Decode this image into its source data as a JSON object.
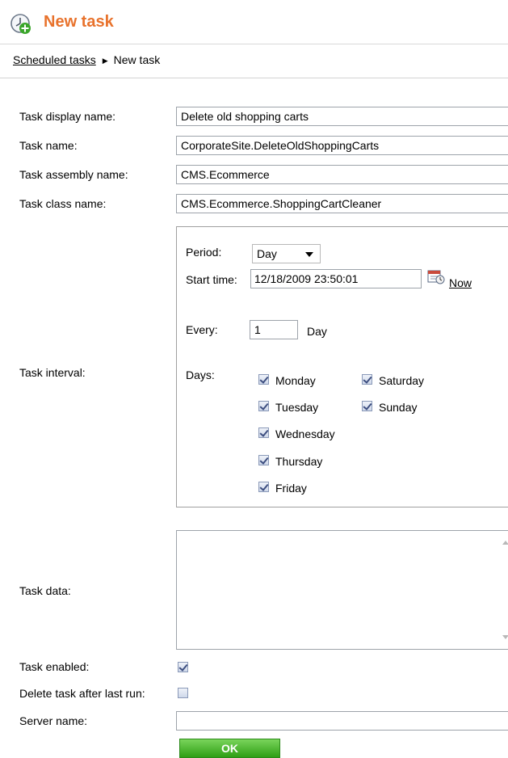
{
  "header": {
    "title": "New task",
    "icon": "scheduled-task-add-icon"
  },
  "breadcrumb": {
    "parent": "Scheduled tasks",
    "separator_icon": "triangle-right-icon",
    "current": "New task"
  },
  "form": {
    "display_name": {
      "label": "Task display name:",
      "value": "Delete old shopping carts"
    },
    "task_name": {
      "label": "Task name:",
      "value": "CorporateSite.DeleteOldShoppingCarts"
    },
    "assembly_name": {
      "label": "Task assembly name:",
      "value": "CMS.Ecommerce"
    },
    "class_name": {
      "label": "Task class name:",
      "value": "CMS.Ecommerce.ShoppingCartCleaner"
    },
    "interval": {
      "label": "Task interval:",
      "period_label": "Period:",
      "period_value": "Day",
      "start_time_label": "Start time:",
      "start_time_value": "12/18/2009 23:50:01",
      "calendar_icon": "calendar-icon",
      "now_link": "Now",
      "every_label": "Every:",
      "every_value": "1",
      "every_unit": "Day",
      "days_label": "Days:",
      "days": [
        {
          "name": "Monday",
          "checked": true
        },
        {
          "name": "Tuesday",
          "checked": true
        },
        {
          "name": "Wednesday",
          "checked": true
        },
        {
          "name": "Thursday",
          "checked": true
        },
        {
          "name": "Friday",
          "checked": true
        },
        {
          "name": "Saturday",
          "checked": true
        },
        {
          "name": "Sunday",
          "checked": true
        }
      ]
    },
    "task_data": {
      "label": "Task data:",
      "value": ""
    },
    "enabled": {
      "label": "Task enabled:",
      "checked": true
    },
    "delete_after": {
      "label": "Delete task after last run:",
      "checked": false
    },
    "server_name": {
      "label": "Server name:",
      "value": ""
    },
    "ok_label": "OK"
  },
  "colors": {
    "title": "#e8722c",
    "ok_button": "#3fae22"
  }
}
